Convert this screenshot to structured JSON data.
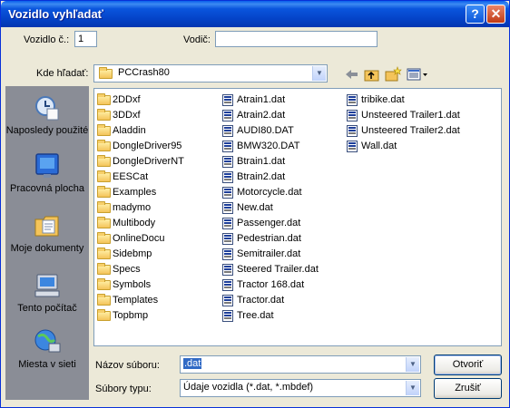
{
  "window": {
    "title": "Vozidlo vyhľadať",
    "help_btn": "?",
    "close_btn": "✕"
  },
  "header": {
    "vehicle_no_label": "Vozidlo č.:",
    "vehicle_no_value": "1",
    "driver_label": "Vodič:",
    "driver_value": ""
  },
  "lookin": {
    "label": "Kde hľadať:",
    "value": "PCCrash80"
  },
  "places": [
    {
      "label": "Naposledy použité",
      "icon": "recent-documents-icon"
    },
    {
      "label": "Pracovná plocha",
      "icon": "desktop-icon"
    },
    {
      "label": "Moje dokumenty",
      "icon": "my-documents-icon"
    },
    {
      "label": "Tento počítač",
      "icon": "my-computer-icon"
    },
    {
      "label": "Miesta v sieti",
      "icon": "network-places-icon"
    }
  ],
  "files": {
    "col1": [
      "2DDxf",
      "3DDxf",
      "Aladdin",
      "DongleDriver95",
      "DongleDriverNT",
      "EESCat",
      "Examples",
      "madymo",
      "Multibody",
      "OnlineDocu",
      "Sidebmp",
      "Specs",
      "Symbols",
      "Templates",
      "Topbmp"
    ],
    "col2": [
      "Atrain1.dat",
      "Atrain2.dat",
      "AUDI80.DAT",
      "BMW320.DAT",
      "Btrain1.dat",
      "Btrain2.dat",
      "Motorcycle.dat",
      "New.dat",
      "Passenger.dat",
      "Pedestrian.dat",
      "Semitrailer.dat",
      "Steered Trailer.dat",
      "Tractor 168.dat",
      "Tractor.dat",
      "Tree.dat"
    ],
    "col3": [
      "tribike.dat",
      "Unsteered Trailer1.dat",
      "Unsteered Trailer2.dat",
      "Wall.dat"
    ]
  },
  "filename": {
    "label": "Názov súboru:",
    "value": ".dat"
  },
  "filetype": {
    "label": "Súbory typu:",
    "value": "Údaje vozidla (*.dat, *.mbdef)"
  },
  "buttons": {
    "open": "Otvoriť",
    "cancel": "Zrušiť"
  },
  "colors": {
    "titlebar": "#0A55DD",
    "sidebar": "#8A8D96",
    "dialog_bg": "#ECE9D8",
    "selection": "#316AC5"
  }
}
